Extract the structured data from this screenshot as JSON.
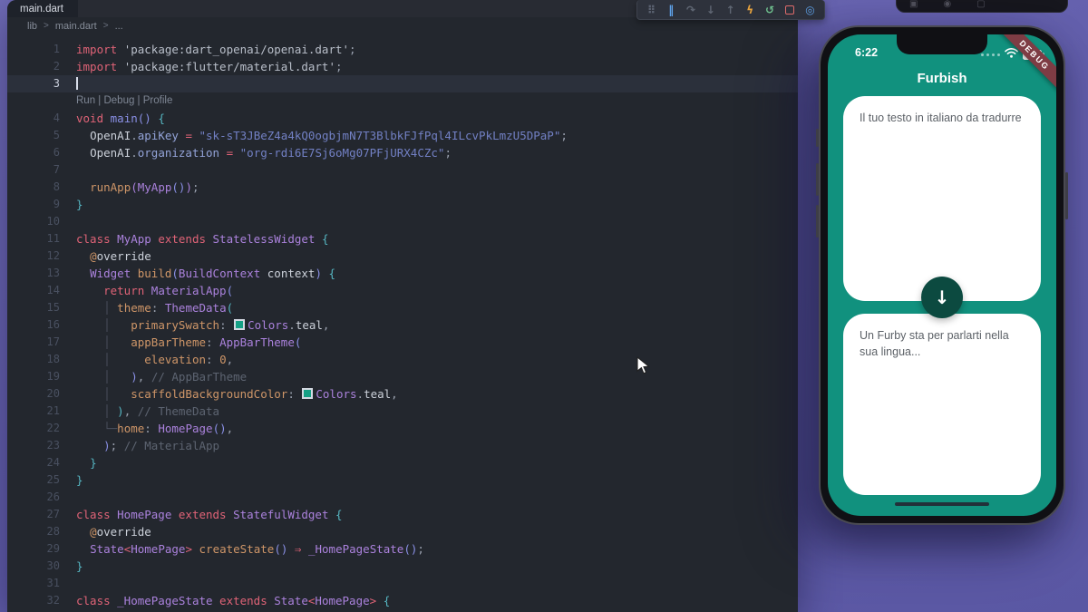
{
  "editor": {
    "tab": "main.dart",
    "breadcrumb": [
      "lib",
      "main.dart",
      "..."
    ],
    "breadcrumb_sep": ">",
    "codelens": "Run | Debug | Profile",
    "debug_toolbar": {
      "icons": [
        {
          "name": "drag-handle",
          "glyph": "⠿",
          "color": "#5a6170"
        },
        {
          "name": "pause",
          "glyph": "‖",
          "color": "#5ea1e8"
        },
        {
          "name": "step-over",
          "glyph": "↷",
          "color": "#5f6673"
        },
        {
          "name": "step-into",
          "glyph": "↓",
          "color": "#5f6673"
        },
        {
          "name": "step-out",
          "glyph": "↑",
          "color": "#5f6673"
        },
        {
          "name": "hot-reload",
          "glyph": "ϟ",
          "color": "#e8a33d"
        },
        {
          "name": "restart",
          "glyph": "↺",
          "color": "#6fbf8e"
        },
        {
          "name": "stop",
          "glyph": "",
          "color": "#e06c6c",
          "box": true
        },
        {
          "name": "widget-inspector",
          "glyph": "◎",
          "color": "#5ea1e8"
        }
      ]
    },
    "lines": [
      {
        "n": 1,
        "t": [
          [
            "kw",
            "import "
          ],
          [
            "strl",
            "'package:dart_openai/openai.dart'"
          ],
          [
            "pun",
            ";"
          ]
        ]
      },
      {
        "n": 2,
        "t": [
          [
            "kw",
            "import "
          ],
          [
            "strl",
            "'package:flutter/material.dart'"
          ],
          [
            "pun",
            ";"
          ]
        ]
      },
      {
        "n": 3,
        "cur": true,
        "t": [
          [
            "cursor",
            ""
          ]
        ]
      },
      {
        "lens": "Run | Debug | Profile"
      },
      {
        "n": 4,
        "t": [
          [
            "kw",
            "void "
          ],
          [
            "b2",
            "main"
          ],
          [
            "b2",
            "()"
          ],
          [
            "pun",
            " "
          ],
          [
            "b1",
            "{"
          ]
        ]
      },
      {
        "n": 5,
        "t": [
          [
            "pun",
            "  "
          ],
          [
            "var",
            "OpenAI"
          ],
          [
            "pun",
            "."
          ],
          [
            "acc",
            "apiKey"
          ],
          [
            "pun",
            " "
          ],
          [
            "op",
            "="
          ],
          [
            "pun",
            " "
          ],
          [
            "str",
            "\"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\""
          ],
          [
            "pun",
            ";"
          ]
        ]
      },
      {
        "n": 6,
        "t": [
          [
            "pun",
            "  "
          ],
          [
            "var",
            "OpenAI"
          ],
          [
            "pun",
            "."
          ],
          [
            "acc",
            "organization"
          ],
          [
            "pun",
            " "
          ],
          [
            "op",
            "="
          ],
          [
            "pun",
            " "
          ],
          [
            "str",
            "\"org-rdi6E7Sj6oMg07PFjURX4CZc\""
          ],
          [
            "pun",
            ";"
          ]
        ]
      },
      {
        "n": 7,
        "t": []
      },
      {
        "n": 8,
        "t": [
          [
            "pun",
            "  "
          ],
          [
            "fn",
            "runApp"
          ],
          [
            "b3",
            "("
          ],
          [
            "type",
            "MyApp"
          ],
          [
            "b2",
            "()"
          ],
          [
            "b3",
            ")"
          ],
          [
            "pun",
            ";"
          ]
        ]
      },
      {
        "n": 9,
        "t": [
          [
            "b1",
            "}"
          ]
        ]
      },
      {
        "n": 10,
        "t": []
      },
      {
        "n": 11,
        "t": [
          [
            "kw",
            "class "
          ],
          [
            "type",
            "MyApp"
          ],
          [
            "kw",
            " extends "
          ],
          [
            "type",
            "StatelessWidget"
          ],
          [
            "pun",
            " "
          ],
          [
            "b1",
            "{"
          ]
        ]
      },
      {
        "n": 12,
        "t": [
          [
            "pun",
            "  "
          ],
          [
            "prop",
            "@"
          ],
          [
            "var",
            "override"
          ]
        ]
      },
      {
        "n": 13,
        "t": [
          [
            "pun",
            "  "
          ],
          [
            "type",
            "Widget"
          ],
          [
            "pun",
            " "
          ],
          [
            "fn",
            "build"
          ],
          [
            "b2",
            "("
          ],
          [
            "type",
            "BuildContext"
          ],
          [
            "pun",
            " "
          ],
          [
            "var",
            "context"
          ],
          [
            "b2",
            ")"
          ],
          [
            "pun",
            " "
          ],
          [
            "b1",
            "{"
          ]
        ]
      },
      {
        "n": 14,
        "t": [
          [
            "pun",
            "    "
          ],
          [
            "kw",
            "return"
          ],
          [
            "pun",
            " "
          ],
          [
            "type",
            "MaterialApp"
          ],
          [
            "b2",
            "("
          ]
        ]
      },
      {
        "n": 15,
        "t": [
          [
            "pun",
            "    "
          ],
          [
            "guide",
            "│"
          ],
          [
            "pun",
            " "
          ],
          [
            "prop",
            "theme"
          ],
          [
            "pun",
            ": "
          ],
          [
            "type",
            "ThemeData"
          ],
          [
            "b1",
            "("
          ]
        ]
      },
      {
        "n": 16,
        "t": [
          [
            "pun",
            "    "
          ],
          [
            "guide",
            "│"
          ],
          [
            "pun",
            "   "
          ],
          [
            "prop",
            "primarySwatch"
          ],
          [
            "pun",
            ": "
          ],
          [
            "swatch",
            ""
          ],
          [
            "type",
            "Colors"
          ],
          [
            "pun",
            "."
          ],
          [
            "var",
            "teal"
          ],
          [
            "pun",
            ","
          ]
        ]
      },
      {
        "n": 17,
        "t": [
          [
            "pun",
            "    "
          ],
          [
            "guide",
            "│"
          ],
          [
            "pun",
            "   "
          ],
          [
            "prop",
            "appBarTheme"
          ],
          [
            "pun",
            ": "
          ],
          [
            "type",
            "AppBarTheme"
          ],
          [
            "b2",
            "("
          ]
        ]
      },
      {
        "n": 18,
        "t": [
          [
            "pun",
            "    "
          ],
          [
            "guide",
            "│"
          ],
          [
            "pun",
            "     "
          ],
          [
            "prop",
            "elevation"
          ],
          [
            "pun",
            ": "
          ],
          [
            "num",
            "0"
          ],
          [
            "pun",
            ","
          ]
        ]
      },
      {
        "n": 19,
        "t": [
          [
            "pun",
            "    "
          ],
          [
            "guide",
            "│"
          ],
          [
            "pun",
            "   "
          ],
          [
            "b2",
            ")"
          ],
          [
            "pun",
            ", "
          ],
          [
            "cmt",
            "// AppBarTheme"
          ]
        ]
      },
      {
        "n": 20,
        "t": [
          [
            "pun",
            "    "
          ],
          [
            "guide",
            "│"
          ],
          [
            "pun",
            "   "
          ],
          [
            "prop",
            "scaffoldBackgroundColor"
          ],
          [
            "pun",
            ": "
          ],
          [
            "swatch",
            ""
          ],
          [
            "type",
            "Colors"
          ],
          [
            "pun",
            "."
          ],
          [
            "var",
            "teal"
          ],
          [
            "pun",
            ","
          ]
        ]
      },
      {
        "n": 21,
        "t": [
          [
            "pun",
            "    "
          ],
          [
            "guide",
            "│"
          ],
          [
            "pun",
            " "
          ],
          [
            "b1",
            ")"
          ],
          [
            "pun",
            ", "
          ],
          [
            "cmt",
            "// ThemeData"
          ]
        ]
      },
      {
        "n": 22,
        "t": [
          [
            "pun",
            "    "
          ],
          [
            "guide",
            "└─"
          ],
          [
            "prop",
            "home"
          ],
          [
            "pun",
            ": "
          ],
          [
            "type",
            "HomePage"
          ],
          [
            "b2",
            "()"
          ],
          [
            "pun",
            ","
          ]
        ]
      },
      {
        "n": 23,
        "t": [
          [
            "pun",
            "    "
          ],
          [
            "b2",
            ")"
          ],
          [
            "pun",
            "; "
          ],
          [
            "cmt",
            "// MaterialApp"
          ]
        ]
      },
      {
        "n": 24,
        "t": [
          [
            "pun",
            "  "
          ],
          [
            "b1",
            "}"
          ]
        ]
      },
      {
        "n": 25,
        "t": [
          [
            "b1",
            "}"
          ]
        ]
      },
      {
        "n": 26,
        "t": []
      },
      {
        "n": 27,
        "t": [
          [
            "kw",
            "class "
          ],
          [
            "type",
            "HomePage"
          ],
          [
            "kw",
            " extends "
          ],
          [
            "type",
            "StatefulWidget"
          ],
          [
            "pun",
            " "
          ],
          [
            "b1",
            "{"
          ]
        ]
      },
      {
        "n": 28,
        "t": [
          [
            "pun",
            "  "
          ],
          [
            "prop",
            "@"
          ],
          [
            "var",
            "override"
          ]
        ]
      },
      {
        "n": 29,
        "t": [
          [
            "pun",
            "  "
          ],
          [
            "type",
            "State"
          ],
          [
            "op",
            "<"
          ],
          [
            "type",
            "HomePage"
          ],
          [
            "op",
            ">"
          ],
          [
            "pun",
            " "
          ],
          [
            "fn",
            "createState"
          ],
          [
            "b2",
            "()"
          ],
          [
            "pun",
            " "
          ],
          [
            "op",
            "⇒"
          ],
          [
            "pun",
            " "
          ],
          [
            "type",
            "_HomePageState"
          ],
          [
            "b2",
            "()"
          ],
          [
            "pun",
            ";"
          ]
        ]
      },
      {
        "n": 30,
        "t": [
          [
            "b1",
            "}"
          ]
        ]
      },
      {
        "n": 31,
        "t": []
      },
      {
        "n": 32,
        "t": [
          [
            "kw",
            "class "
          ],
          [
            "type",
            "_HomePageState"
          ],
          [
            "kw",
            " extends "
          ],
          [
            "type",
            "State"
          ],
          [
            "op",
            "<"
          ],
          [
            "type",
            "HomePage"
          ],
          [
            "op",
            ">"
          ],
          [
            "pun",
            " "
          ],
          [
            "b1",
            "{"
          ]
        ]
      }
    ]
  },
  "simulator_toolbar": {
    "icons": [
      {
        "name": "simulator-screenshot",
        "glyph": "▣"
      },
      {
        "name": "simulator-device",
        "glyph": "◉"
      },
      {
        "name": "simulator-window",
        "glyph": "▢"
      }
    ]
  },
  "phone": {
    "status_time": "6:22",
    "app_title": "Furbish",
    "debug_banner": "DEBUG",
    "input_placeholder": "Il tuo testo in italiano da tradurre",
    "output_text": "Un Furby sta per parlarti nella sua lingua...",
    "fab_arrow": "↓",
    "colors": {
      "app_teal": "#11917e",
      "fab_dark_teal": "#0c4a40",
      "banner_red": "#7e3c44"
    }
  }
}
